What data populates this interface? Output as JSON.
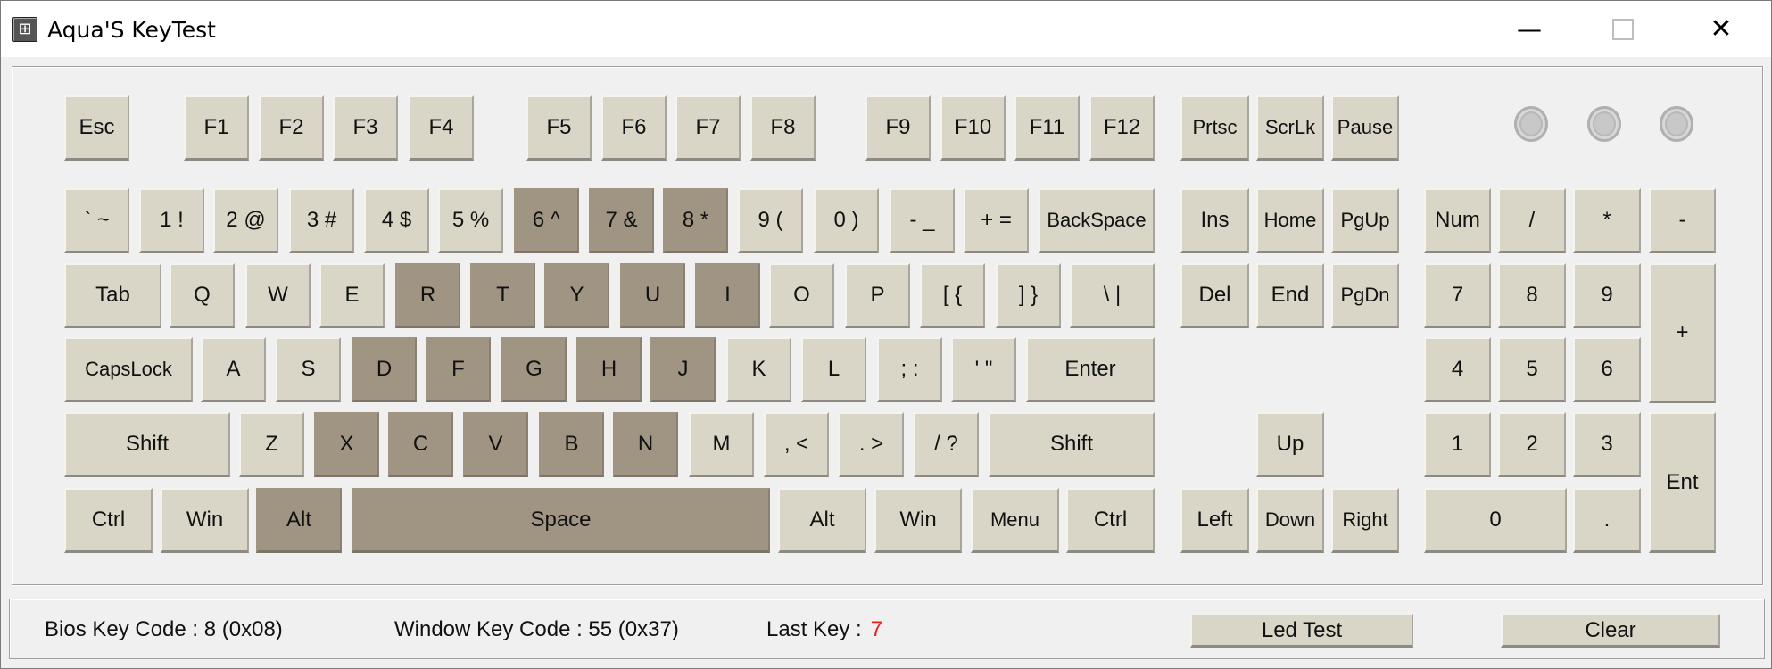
{
  "window": {
    "title": "Aqua'S KeyTest",
    "icon": "keyboard-grid-icon",
    "controls": {
      "minimize": "—",
      "maximize": "",
      "close": "✕"
    }
  },
  "keyboard": {
    "pressed_color": "#a09583",
    "key_color": "#d9d6c7",
    "keys": [
      {
        "id": "esc",
        "label": "Esc",
        "pressed": false
      },
      {
        "id": "f1",
        "label": "F1",
        "pressed": false
      },
      {
        "id": "f2",
        "label": "F2",
        "pressed": false
      },
      {
        "id": "f3",
        "label": "F3",
        "pressed": false
      },
      {
        "id": "f4",
        "label": "F4",
        "pressed": false
      },
      {
        "id": "f5",
        "label": "F5",
        "pressed": false
      },
      {
        "id": "f6",
        "label": "F6",
        "pressed": false
      },
      {
        "id": "f7",
        "label": "F7",
        "pressed": false
      },
      {
        "id": "f8",
        "label": "F8",
        "pressed": false
      },
      {
        "id": "f9",
        "label": "F9",
        "pressed": false
      },
      {
        "id": "f10",
        "label": "F10",
        "pressed": false
      },
      {
        "id": "f11",
        "label": "F11",
        "pressed": false
      },
      {
        "id": "f12",
        "label": "F12",
        "pressed": false
      },
      {
        "id": "prtsc",
        "label": "Prtsc",
        "pressed": false
      },
      {
        "id": "scrlk",
        "label": "ScrLk",
        "pressed": false
      },
      {
        "id": "pause",
        "label": "Pause",
        "pressed": false
      },
      {
        "id": "backtick",
        "label": "` ~",
        "pressed": false
      },
      {
        "id": "1",
        "label": "1 !",
        "pressed": false
      },
      {
        "id": "2",
        "label": "2 @",
        "pressed": false
      },
      {
        "id": "3",
        "label": "3 #",
        "pressed": false
      },
      {
        "id": "4",
        "label": "4 $",
        "pressed": false
      },
      {
        "id": "5",
        "label": "5 %",
        "pressed": false
      },
      {
        "id": "6",
        "label": "6 ^",
        "pressed": true
      },
      {
        "id": "7",
        "label": "7 &",
        "pressed": true
      },
      {
        "id": "8",
        "label": "8 *",
        "pressed": true
      },
      {
        "id": "9",
        "label": "9 (",
        "pressed": false
      },
      {
        "id": "0",
        "label": "0 )",
        "pressed": false
      },
      {
        "id": "minus",
        "label": "- _",
        "pressed": false
      },
      {
        "id": "equals",
        "label": "+ =",
        "pressed": false
      },
      {
        "id": "backspace",
        "label": "BackSpace",
        "pressed": false
      },
      {
        "id": "ins",
        "label": "Ins",
        "pressed": false
      },
      {
        "id": "home",
        "label": "Home",
        "pressed": false
      },
      {
        "id": "pgup",
        "label": "PgUp",
        "pressed": false
      },
      {
        "id": "numlock",
        "label": "Num",
        "pressed": false
      },
      {
        "id": "numdiv",
        "label": "/",
        "pressed": false
      },
      {
        "id": "nummul",
        "label": "*",
        "pressed": false
      },
      {
        "id": "numsub",
        "label": "-",
        "pressed": false
      },
      {
        "id": "tab",
        "label": "Tab",
        "pressed": false
      },
      {
        "id": "q",
        "label": "Q",
        "pressed": false
      },
      {
        "id": "w",
        "label": "W",
        "pressed": false
      },
      {
        "id": "e",
        "label": "E",
        "pressed": false
      },
      {
        "id": "r",
        "label": "R",
        "pressed": true
      },
      {
        "id": "t",
        "label": "T",
        "pressed": true
      },
      {
        "id": "y",
        "label": "Y",
        "pressed": true
      },
      {
        "id": "u",
        "label": "U",
        "pressed": true
      },
      {
        "id": "i",
        "label": "I",
        "pressed": true
      },
      {
        "id": "o",
        "label": "O",
        "pressed": false
      },
      {
        "id": "p",
        "label": "P",
        "pressed": false
      },
      {
        "id": "lbracket",
        "label": "[ {",
        "pressed": false
      },
      {
        "id": "rbracket",
        "label": "] }",
        "pressed": false
      },
      {
        "id": "backslash",
        "label": "\\ |",
        "pressed": false
      },
      {
        "id": "del",
        "label": "Del",
        "pressed": false
      },
      {
        "id": "end",
        "label": "End",
        "pressed": false
      },
      {
        "id": "pgdn",
        "label": "PgDn",
        "pressed": false
      },
      {
        "id": "num7",
        "label": "7",
        "pressed": false
      },
      {
        "id": "num8",
        "label": "8",
        "pressed": false
      },
      {
        "id": "num9",
        "label": "9",
        "pressed": false
      },
      {
        "id": "numadd",
        "label": "+",
        "pressed": false
      },
      {
        "id": "capslock",
        "label": "CapsLock",
        "pressed": false
      },
      {
        "id": "a",
        "label": "A",
        "pressed": false
      },
      {
        "id": "s",
        "label": "S",
        "pressed": false
      },
      {
        "id": "d",
        "label": "D",
        "pressed": true
      },
      {
        "id": "f",
        "label": "F",
        "pressed": true
      },
      {
        "id": "g",
        "label": "G",
        "pressed": true
      },
      {
        "id": "h",
        "label": "H",
        "pressed": true
      },
      {
        "id": "j",
        "label": "J",
        "pressed": true
      },
      {
        "id": "k",
        "label": "K",
        "pressed": false
      },
      {
        "id": "l",
        "label": "L",
        "pressed": false
      },
      {
        "id": "semicolon",
        "label": "; :",
        "pressed": false
      },
      {
        "id": "quote",
        "label": "' \"",
        "pressed": false
      },
      {
        "id": "enter",
        "label": "Enter",
        "pressed": false
      },
      {
        "id": "num4",
        "label": "4",
        "pressed": false
      },
      {
        "id": "num5",
        "label": "5",
        "pressed": false
      },
      {
        "id": "num6",
        "label": "6",
        "pressed": false
      },
      {
        "id": "lshift",
        "label": "Shift",
        "pressed": false
      },
      {
        "id": "z",
        "label": "Z",
        "pressed": false
      },
      {
        "id": "x",
        "label": "X",
        "pressed": true
      },
      {
        "id": "c",
        "label": "C",
        "pressed": true
      },
      {
        "id": "v",
        "label": "V",
        "pressed": true
      },
      {
        "id": "b",
        "label": "B",
        "pressed": true
      },
      {
        "id": "n",
        "label": "N",
        "pressed": true
      },
      {
        "id": "m",
        "label": "M",
        "pressed": false
      },
      {
        "id": "comma",
        "label": ", <",
        "pressed": false
      },
      {
        "id": "period",
        "label": ". >",
        "pressed": false
      },
      {
        "id": "slash",
        "label": "/ ?",
        "pressed": false
      },
      {
        "id": "rshift",
        "label": "Shift",
        "pressed": false
      },
      {
        "id": "up",
        "label": "Up",
        "pressed": false
      },
      {
        "id": "num1",
        "label": "1",
        "pressed": false
      },
      {
        "id": "num2",
        "label": "2",
        "pressed": false
      },
      {
        "id": "num3",
        "label": "3",
        "pressed": false
      },
      {
        "id": "numenter",
        "label": "Ent",
        "pressed": false
      },
      {
        "id": "lctrl",
        "label": "Ctrl",
        "pressed": false
      },
      {
        "id": "lwin",
        "label": "Win",
        "pressed": false
      },
      {
        "id": "lalt",
        "label": "Alt",
        "pressed": true
      },
      {
        "id": "space",
        "label": "Space",
        "pressed": true
      },
      {
        "id": "ralt",
        "label": "Alt",
        "pressed": false
      },
      {
        "id": "rwin",
        "label": "Win",
        "pressed": false
      },
      {
        "id": "menu",
        "label": "Menu",
        "pressed": false
      },
      {
        "id": "rctrl",
        "label": "Ctrl",
        "pressed": false
      },
      {
        "id": "left",
        "label": "Left",
        "pressed": false
      },
      {
        "id": "down",
        "label": "Down",
        "pressed": false
      },
      {
        "id": "right",
        "label": "Right",
        "pressed": false
      },
      {
        "id": "num0",
        "label": "0",
        "pressed": false
      },
      {
        "id": "numdot",
        "label": ".",
        "pressed": false
      }
    ],
    "leds": [
      {
        "name": "num-lock-led",
        "on": false
      },
      {
        "name": "caps-lock-led",
        "on": false
      },
      {
        "name": "scroll-lock-led",
        "on": false
      }
    ]
  },
  "status": {
    "bios_key_code": "Bios Key Code : 8 (0x08)",
    "window_key_code": "Window Key Code : 55 (0x37)",
    "last_key_label": "Last Key :",
    "last_key_value": "7",
    "last_key_color": "#e8201f",
    "led_test_label": "Led Test",
    "clear_label": "Clear"
  }
}
